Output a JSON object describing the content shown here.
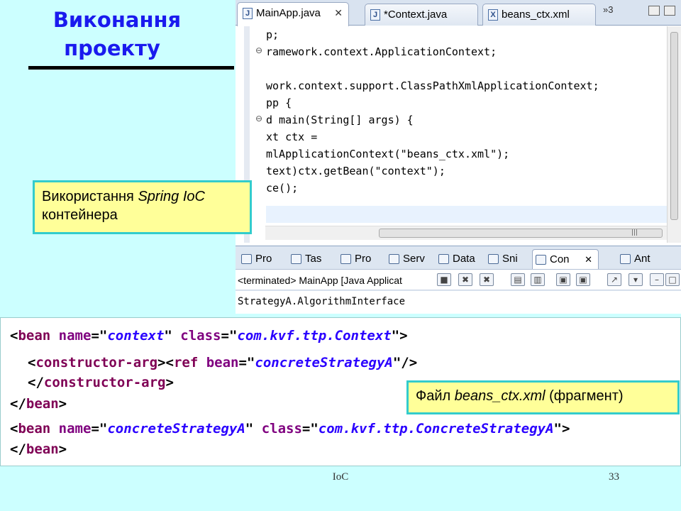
{
  "slide": {
    "title_line1": "Виконання",
    "title_line2": "проекту",
    "footer_center": "IoC",
    "page_number": "33"
  },
  "eclipse": {
    "editor_tabs": [
      {
        "label": "MainApp.java",
        "icon": "java-file-icon",
        "active": true,
        "close": "✕"
      },
      {
        "label": "*Context.java",
        "icon": "java-file-icon",
        "active": false
      },
      {
        "label": "beans_ctx.xml",
        "icon": "xml-file-icon",
        "active": false
      }
    ],
    "overflow_label": "»3",
    "code_lines": [
      "p;",
      "ramework.context.ApplicationContext;",
      "",
      "work.context.support.ClassPathXmlApplicationContext;",
      "pp {",
      "d main(String[] args) {",
      "xt ctx =",
      "mlApplicationContext(\"beans_ctx.xml\");",
      "text)ctx.getBean(\"context\");",
      "ce();"
    ],
    "view_tabs": [
      {
        "label": "Pro",
        "icon": "problems-icon"
      },
      {
        "label": "Tas",
        "icon": "tasks-icon"
      },
      {
        "label": "Pro",
        "icon": "properties-icon"
      },
      {
        "label": "Serv",
        "icon": "servers-icon"
      },
      {
        "label": "Data",
        "icon": "data-source-icon"
      },
      {
        "label": "Sni",
        "icon": "snippets-icon"
      },
      {
        "label": "Con",
        "icon": "console-icon",
        "active": true,
        "close": "✕"
      },
      {
        "label": "Ant",
        "icon": "ant-icon"
      }
    ],
    "console_header": "<terminated> MainApp [Java Applicat",
    "console_output": "StrategyA.AlgorithmInterface"
  },
  "notes": {
    "spring_prefix": "Використання ",
    "spring_italic": "Spring IoC",
    "spring_suffix": " контейнера",
    "file_prefix": "Файл ",
    "file_italic": "beans_ctx.xml",
    "file_suffix": " (фрагмент)"
  },
  "xml": {
    "bean1_name": "context",
    "bean1_class": "com.kvf.ttp.Context",
    "ref_bean": "concreteStrategyA",
    "bean2_name": "concreteStrategyA",
    "bean2_class": "com.kvf.ttp.ConcreteStrategyA",
    "tag_bean": "bean",
    "tag_ctor": "constructor-arg",
    "tag_ref": "ref"
  }
}
